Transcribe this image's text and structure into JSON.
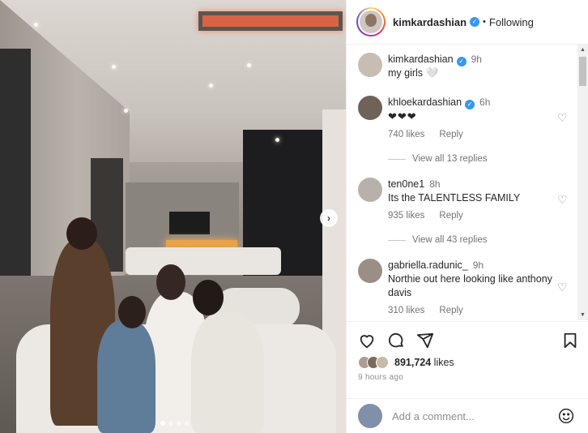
{
  "post": {
    "author": "kimkardashian",
    "follow_status": "Following",
    "separator": "•",
    "verified_mark": "✓",
    "next_glyph": "›",
    "carousel_count": 4,
    "carousel_active": 0
  },
  "caption": {
    "user": "kimkardashian",
    "time": "9h",
    "text": "my girls 🤍"
  },
  "comments": [
    {
      "user": "khloekardashian",
      "time": "6h",
      "text": "❤❤❤",
      "likes": "740 likes",
      "reply": "Reply",
      "replies_label": "View all 13 replies",
      "verified": true,
      "like_icon": "heart-outline-icon"
    },
    {
      "user": "ten0ne1",
      "time": "8h",
      "text": "Its the TALENTLESS FAMILY",
      "likes": "935 likes",
      "reply": "Reply",
      "replies_label": "View all 43 replies",
      "verified": false,
      "like_icon": "heart-outline-icon"
    },
    {
      "user": "gabriella.radunic_",
      "time": "9h",
      "text": "Northie out here looking like anthony davis",
      "likes": "310 likes",
      "reply": "Reply",
      "verified": false,
      "like_icon": "heart-outline-icon"
    }
  ],
  "actions": {
    "icons": [
      "heart-icon",
      "comment-icon",
      "share-icon",
      "save-icon"
    ],
    "likes_count": "891,724",
    "likes_suffix": " likes",
    "time_ago": "9 hours ago"
  },
  "composer": {
    "placeholder": "Add a comment...",
    "emoji_icon": "smiley-icon"
  },
  "scrollbar": {
    "up": "▲",
    "down": "▼"
  },
  "colors": {
    "accent": "#3897f0",
    "like_red": "#ed4956",
    "muted": "#737373"
  }
}
